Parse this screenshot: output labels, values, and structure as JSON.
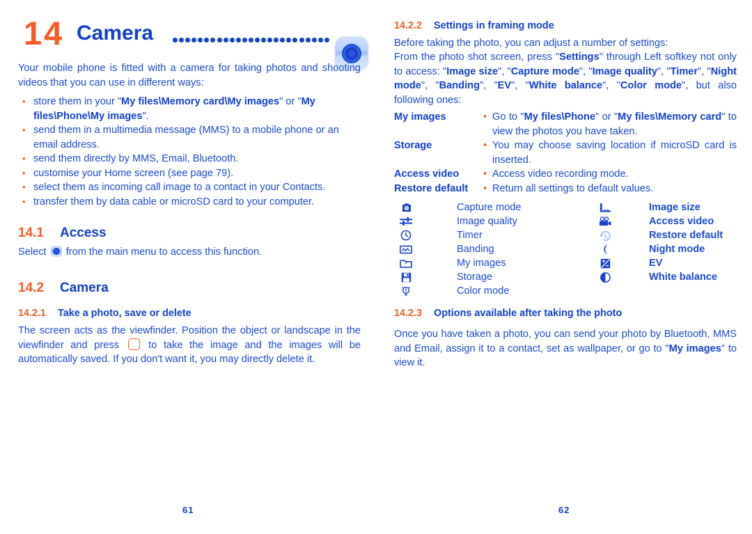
{
  "meta": {
    "accent_blue": "#1340cc",
    "body_blue": "#1c4ad0",
    "accent_orange": "#fa5a28"
  },
  "chapter": {
    "number": "14",
    "name": "Camera",
    "leader_dots": 25,
    "app_icon": "camera-app-icon"
  },
  "left_page": {
    "folio": "61",
    "intro": "Your mobile phone is fitted with a camera for taking photos and shooting videos that you can use in different ways:",
    "bullets": [
      {
        "parts": [
          {
            "t": "store them in your \"",
            "b": false
          },
          {
            "t": "My files\\Memory card\\My images",
            "b": true
          },
          {
            "t": "\" or \"",
            "b": false
          },
          {
            "t": "My files\\Phone\\My images",
            "b": true
          },
          {
            "t": "\".",
            "b": false
          }
        ]
      },
      {
        "parts": [
          {
            "t": "send them in a multimedia message (MMS) to a mobile phone or an email address.",
            "b": false
          }
        ]
      },
      {
        "parts": [
          {
            "t": "send them directly by MMS, Email, Bluetooth.",
            "b": false
          }
        ]
      },
      {
        "parts": [
          {
            "t": "customise your Home screen (see page 79).",
            "b": false
          }
        ]
      },
      {
        "parts": [
          {
            "t": "select them as incoming call image to a contact in your Contacts.",
            "b": false
          }
        ]
      },
      {
        "parts": [
          {
            "t": "transfer them by data cable or microSD card to your computer.",
            "b": false
          }
        ]
      }
    ],
    "section_access": {
      "num": "14.1",
      "title": "Access"
    },
    "access_text_before": "Select",
    "access_icon": "camera-app-icon-inline",
    "access_text_after": "from the main menu to access this function.",
    "section_camera": {
      "num": "14.2",
      "title": "Camera"
    },
    "sub_take_photo": {
      "num": "14.2.1",
      "title": "Take a photo, save or delete"
    },
    "take_photo_text_1": "The screen acts as the viewfinder. Position the object or landscape in the viewfinder and press",
    "take_photo_key": "ok-key-icon",
    "take_photo_text_2": "to take the image and the images will be automatically saved. If you don't want it, you may directly delete it."
  },
  "right_page": {
    "folio": "62",
    "sub_settings": {
      "num": "14.2.2",
      "title": "Settings in framing mode"
    },
    "settings_intro": "Before taking the photo, you can adjust a number of settings:",
    "settings_body": [
      {
        "t": "From the photo shot screen, press \"",
        "b": false
      },
      {
        "t": "Settings",
        "b": true
      },
      {
        "t": "\" through Left softkey not only to access: \"",
        "b": false
      },
      {
        "t": "Image size",
        "b": true
      },
      {
        "t": "\", \"",
        "b": false
      },
      {
        "t": "Capture mode",
        "b": true
      },
      {
        "t": "\", \"",
        "b": false
      },
      {
        "t": "Image quality",
        "b": true
      },
      {
        "t": "\", \"",
        "b": false
      },
      {
        "t": "Timer",
        "b": true
      },
      {
        "t": "\", \"",
        "b": false
      },
      {
        "t": "Night mode",
        "b": true
      },
      {
        "t": "\", \"",
        "b": false
      },
      {
        "t": "Banding",
        "b": true
      },
      {
        "t": "\", \"",
        "b": false
      },
      {
        "t": "EV",
        "b": true
      },
      {
        "t": "\", \"",
        "b": false
      },
      {
        "t": "White balance",
        "b": true
      },
      {
        "t": "\", \"",
        "b": false
      },
      {
        "t": "Color mode",
        "b": true
      },
      {
        "t": "\", but also following ones:",
        "b": false
      }
    ],
    "settings_table": [
      {
        "label": "My images",
        "parts": [
          {
            "t": "Go to \"",
            "b": false
          },
          {
            "t": "My files\\Phone",
            "b": true
          },
          {
            "t": "\" or \"",
            "b": false
          },
          {
            "t": "My files\\Memory card",
            "b": true
          },
          {
            "t": "\" to view the photos you have taken.",
            "b": false
          }
        ]
      },
      {
        "label": "Storage",
        "parts": [
          {
            "t": "You may choose saving location if microSD card is inserted.",
            "b": false
          }
        ]
      },
      {
        "label": "Access video",
        "parts": [
          {
            "t": "Access video recording mode.",
            "b": false
          }
        ]
      },
      {
        "label": "Restore default",
        "parts": [
          {
            "t": "Return all settings to default values.",
            "b": false
          }
        ]
      }
    ],
    "legend_left": [
      {
        "icon": "camera-icon",
        "label": "Capture mode"
      },
      {
        "icon": "sliders-icon",
        "label": "Image quality"
      },
      {
        "icon": "clock-icon",
        "label": "Timer"
      },
      {
        "icon": "waveform-icon",
        "label": "Banding"
      },
      {
        "icon": "folder-star-icon",
        "label": "My images"
      },
      {
        "icon": "floppy-disk-icon",
        "label": "Storage"
      },
      {
        "icon": "lightbulb-icon",
        "label": "Color mode"
      }
    ],
    "legend_right": [
      {
        "icon": "ruler-corner-icon",
        "label": "Image size"
      },
      {
        "icon": "movie-camera-icon",
        "label": "Access video"
      },
      {
        "icon": "restore-icon",
        "label": "Restore default"
      },
      {
        "icon": "moon-icon",
        "label": "Night mode"
      },
      {
        "icon": "plus-minus-icon",
        "label": "EV"
      },
      {
        "icon": "contrast-icon",
        "label": "White balance"
      }
    ],
    "sub_options": {
      "num": "14.2.3",
      "title": "Options available after taking the photo"
    },
    "options_body": [
      {
        "t": "Once you have taken a photo, you can send your photo by Bluetooth, MMS and Email, assign it to a contact, set as wallpaper, or go to \"",
        "b": false
      },
      {
        "t": "My images",
        "b": true
      },
      {
        "t": "\" to view it.",
        "b": false
      }
    ]
  }
}
